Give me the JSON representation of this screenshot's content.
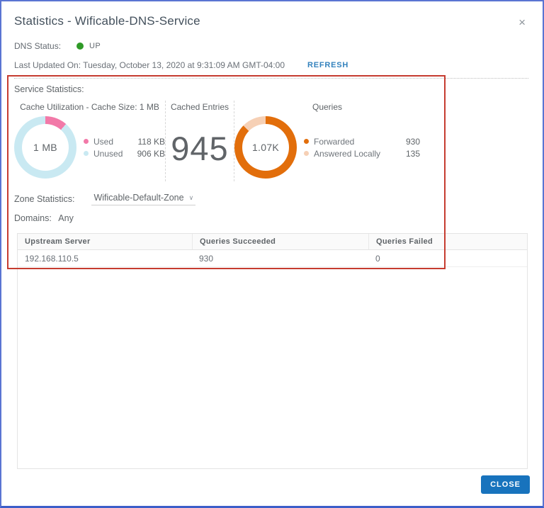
{
  "dialog": {
    "title": "Statistics - Wificable-DNS-Service",
    "close_icon": "×"
  },
  "status": {
    "label": "DNS Status:",
    "value": "UP",
    "dot_color": "#2f9a27"
  },
  "last_updated": {
    "label": "Last Updated On: Tuesday, October 13, 2020 at 9:31:09 AM GMT-04:00",
    "refresh_label": "REFRESH"
  },
  "service_statistics_label": "Service Statistics:",
  "chart_data": [
    {
      "type": "pie",
      "subtype": "donut",
      "title": "Cache Utilization - Cache Size: 1 MB",
      "center_label": "1 MB",
      "unit": "KB",
      "series": [
        {
          "name": "Used",
          "value": 118,
          "display": "118 KB",
          "color": "#f279a8"
        },
        {
          "name": "Unused",
          "value": 906,
          "display": "906 KB",
          "color": "#c9e9f2"
        }
      ]
    },
    {
      "type": "value",
      "title": "Cached Entries",
      "value": "945"
    },
    {
      "type": "pie",
      "subtype": "donut",
      "title": "Queries",
      "center_label": "1.07K",
      "series": [
        {
          "name": "Forwarded",
          "value": 930,
          "display": "930",
          "color": "#e26e0b"
        },
        {
          "name": "Answered Locally",
          "value": 135,
          "display": "135",
          "color": "#f6d0b5"
        }
      ]
    }
  ],
  "zone": {
    "label": "Zone Statistics:",
    "selected": "Wificable-Default-Zone",
    "chevron": "∨"
  },
  "domains": {
    "label": "Domains:",
    "value": "Any"
  },
  "table": {
    "columns": [
      "Upstream Server",
      "Queries Succeeded",
      "Queries Failed"
    ],
    "rows": [
      [
        "192.168.110.5",
        "930",
        "0"
      ]
    ]
  },
  "footer": {
    "close_label": "CLOSE"
  },
  "colors": {
    "primary_button": "#1873bd",
    "refresh_link": "#3382bd",
    "status_up": "#2f9a27",
    "annotation_red": "#c63c30",
    "window_border_blue": "#5a74d2"
  }
}
